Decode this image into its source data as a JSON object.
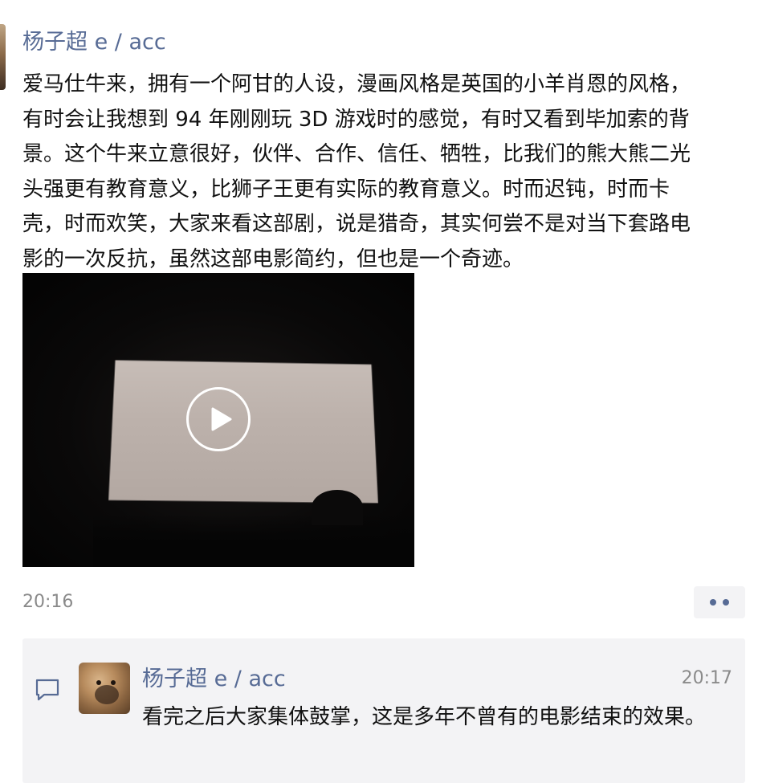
{
  "post": {
    "author": "杨子超 e / acc",
    "text": "爱马仕牛来，拥有一个阿甘的人设，漫画风格是英国的小羊肖恩的风格，\n有时会让我想到 94 年刚刚玩 3D 游戏时的感觉，有时又看到毕加索的背\n景。这个牛来立意很好，伙伴、合作、信任、牺牲，比我们的熊大熊二光\n头强更有教育意义，比狮子王更有实际的教育意义。时而迟钝，时而卡\n壳，时而欢笑，大家来看这部剧，说是猎奇，其实何尝不是对当下套路电\n影的一次反抗，虽然这部电影简约，但也是一个奇迹。",
    "time": "20:16",
    "video": {
      "play_icon": "play-icon"
    },
    "more_icon": "more-dots-icon"
  },
  "comments": [
    {
      "author": "杨子超 e / acc",
      "time": "20:17",
      "text": "看完之后大家集体鼓掌，这是多年不曾有的电影结束的效果。"
    }
  ],
  "colors": {
    "link": "#576b95",
    "text": "#111111",
    "muted": "#8a8a8a",
    "panel": "#f3f3f5"
  }
}
